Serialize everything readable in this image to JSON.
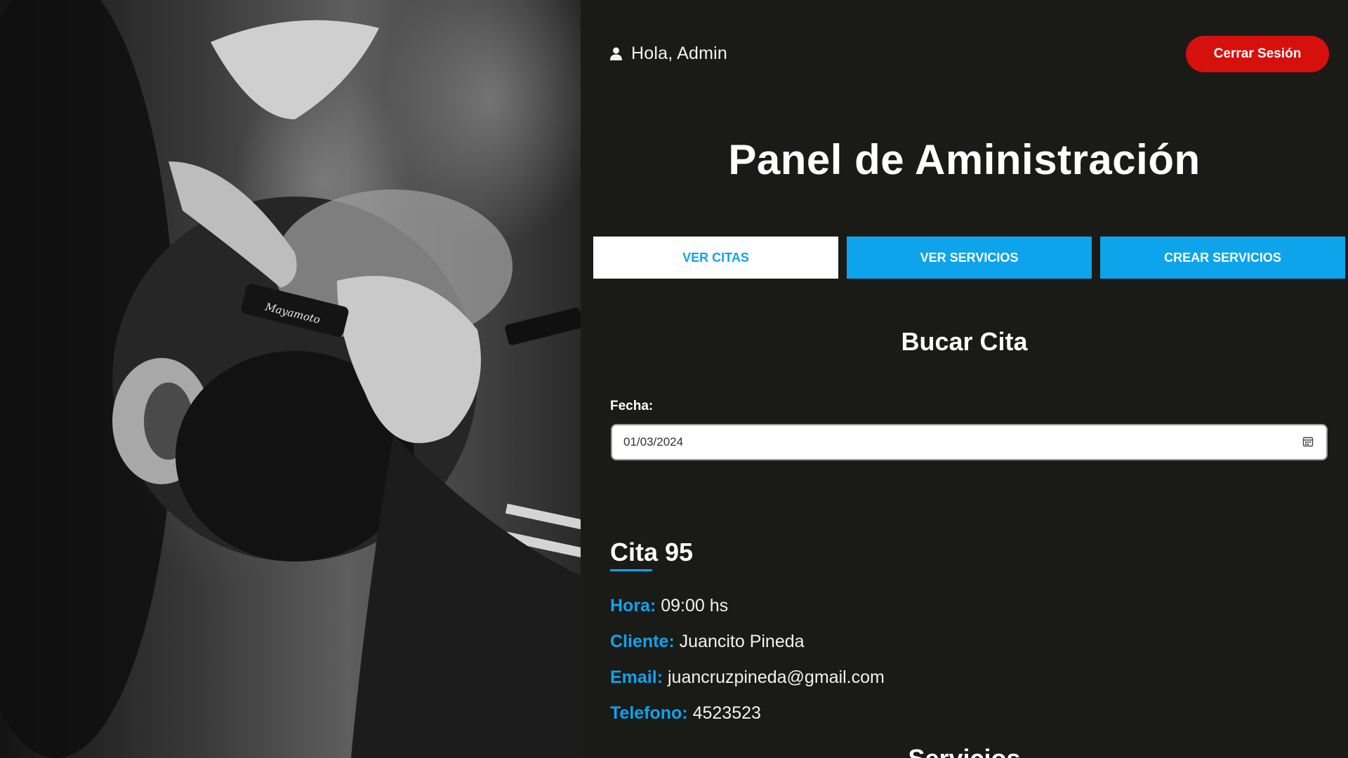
{
  "header": {
    "greeting": "Hola, Admin",
    "logout_label": "Cerrar Sesión"
  },
  "page_title": "Panel de Aministración",
  "tabs": [
    {
      "label": "VER CITAS",
      "active": true
    },
    {
      "label": "VER SERVICIOS",
      "active": false
    },
    {
      "label": "CREAR SERVICIOS",
      "active": false
    }
  ],
  "search": {
    "title": "Bucar Cita",
    "date_label": "Fecha:",
    "date_value": "01/03/2024"
  },
  "cita": {
    "title": "Cita 95",
    "hora_label": "Hora:",
    "hora_value": "09:00 hs",
    "cliente_label": "Cliente:",
    "cliente_value": "Juancito Pineda",
    "email_label": "Email:",
    "email_value": "juancruzpineda@gmail.com",
    "telefono_label": "Telefono:",
    "telefono_value": "4523523"
  },
  "servicios_title": "Servicios",
  "photo": {
    "razor_text": "Mayamoto"
  },
  "colors": {
    "background": "#1a1a17",
    "accent_blue": "#0da4ec",
    "logout_red": "#d6100c"
  }
}
